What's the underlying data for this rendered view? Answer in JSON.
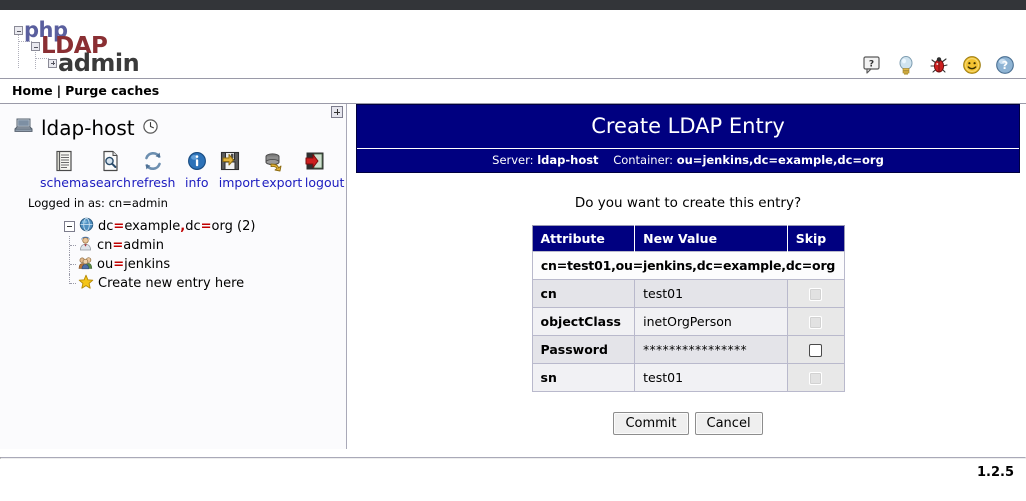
{
  "logo": {
    "line1": "php",
    "line2": "LDAP",
    "line3": "admin"
  },
  "top_icons": [
    {
      "name": "help-balloon-icon",
      "title": "?"
    },
    {
      "name": "lightbulb-icon",
      "title": "hints"
    },
    {
      "name": "bug-icon",
      "title": "report bug"
    },
    {
      "name": "smiley-icon",
      "title": "feedback"
    },
    {
      "name": "question-sphere-icon",
      "title": "help"
    }
  ],
  "breadcrumb": {
    "home": "Home",
    "separator": "|",
    "purge": "Purge caches"
  },
  "sidebar": {
    "server_name": "ldap-host",
    "toolbar": [
      {
        "label": "schema",
        "icon": "schema-icon"
      },
      {
        "label": "search",
        "icon": "search-icon"
      },
      {
        "label": "refresh",
        "icon": "refresh-icon"
      },
      {
        "label": "info",
        "icon": "info-icon"
      },
      {
        "label": "import",
        "icon": "import-icon"
      },
      {
        "label": "export",
        "icon": "export-icon"
      },
      {
        "label": "logout",
        "icon": "logout-icon"
      }
    ],
    "logged_in_as": "Logged in as: cn=admin",
    "tree": {
      "root": {
        "prefix": "dc",
        "value1": "example",
        "prefix2": "dc",
        "value2": "org",
        "count": "(2)"
      },
      "children": [
        {
          "prefix": "cn",
          "value": "admin",
          "icon": "user-icon"
        },
        {
          "prefix": "ou",
          "value": "jenkins",
          "icon": "group-icon"
        }
      ],
      "create_label": "Create new entry here"
    }
  },
  "main": {
    "title": "Create LDAP Entry",
    "server_label": "Server:",
    "server_value": "ldap-host",
    "container_label": "Container:",
    "container_value": "ou=jenkins,dc=example,dc=org",
    "question": "Do you want to create this entry?",
    "table": {
      "headers": [
        "Attribute",
        "New Value",
        "Skip"
      ],
      "dn": "cn=test01,ou=jenkins,dc=example,dc=org",
      "rows": [
        {
          "attribute": "cn",
          "value": "test01",
          "skip_checked": false,
          "skip_enabled": false
        },
        {
          "attribute": "objectClass",
          "value": "inetOrgPerson",
          "skip_checked": false,
          "skip_enabled": false
        },
        {
          "attribute": "Password",
          "value": "****************",
          "skip_checked": false,
          "skip_enabled": true
        },
        {
          "attribute": "sn",
          "value": "test01",
          "skip_checked": false,
          "skip_enabled": false
        }
      ]
    },
    "commit_label": "Commit",
    "cancel_label": "Cancel"
  },
  "footer": {
    "version": "1.2.5"
  },
  "colors": {
    "panel_header": "#000080",
    "link": "#1b1bbf",
    "accent_red": "#c00000",
    "chrome": "#333539"
  }
}
